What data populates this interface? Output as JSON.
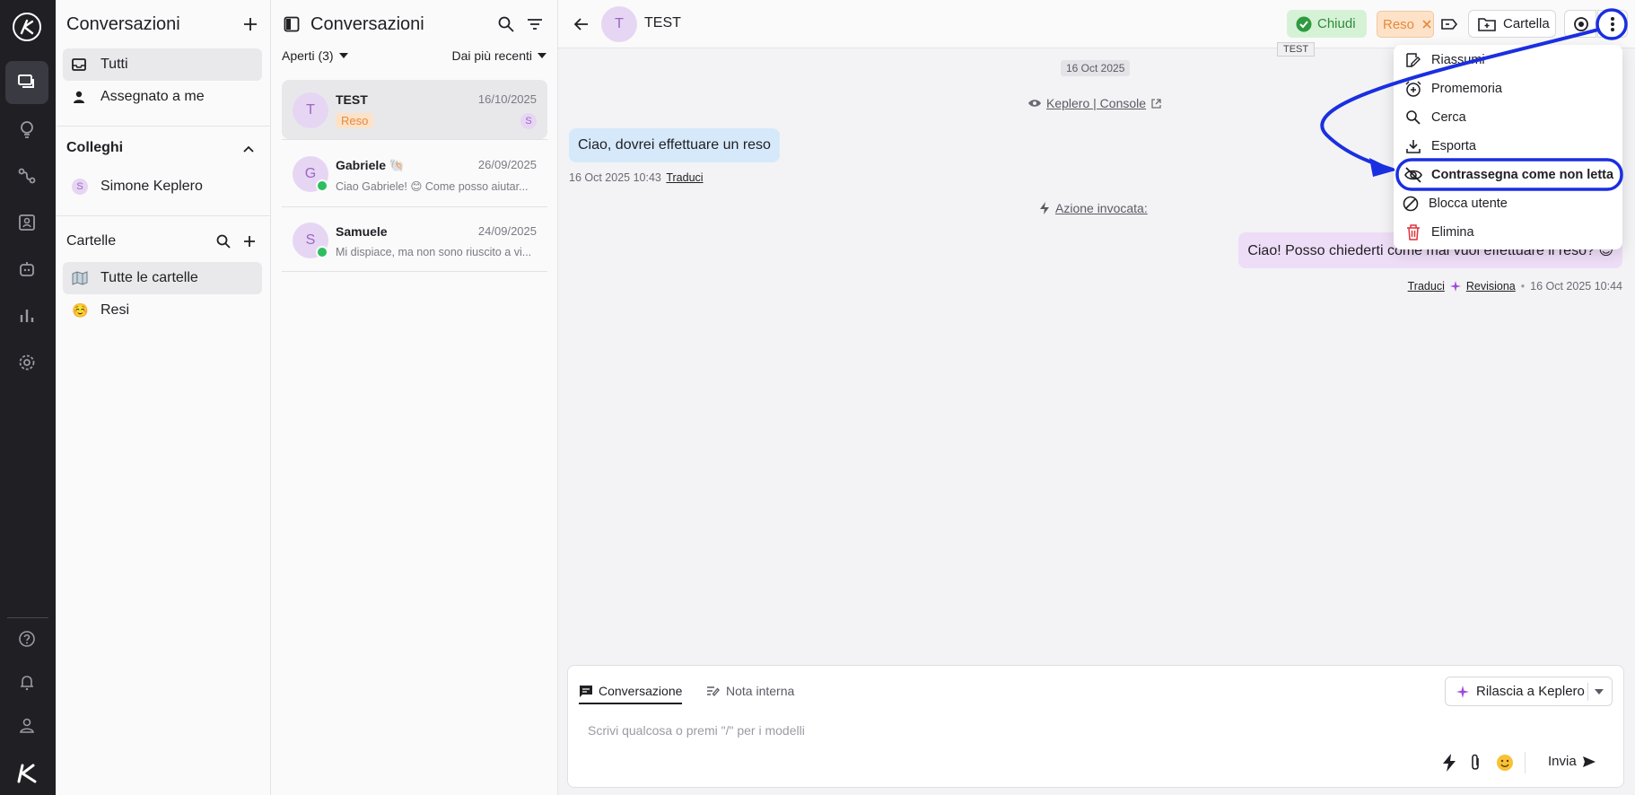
{
  "sidebar_panel": {
    "title": "Conversazioni",
    "nav": [
      {
        "label": "Tutti",
        "icon": "inbox-icon"
      },
      {
        "label": "Assegnato a me",
        "icon": "person-icon"
      }
    ],
    "colleagues_title": "Colleghi",
    "colleagues": [
      {
        "initial": "S",
        "name": "Simone Keplero"
      }
    ],
    "folders_title": "Cartelle",
    "folders": [
      {
        "label": "Tutte le cartelle",
        "icon": "folder-map-icon"
      },
      {
        "label": "Resi",
        "icon": "relieved-emoji-icon",
        "emoji": "☺️"
      }
    ]
  },
  "conv_list": {
    "title": "Conversazioni",
    "filter_label": "Aperti (3)",
    "sort_label": "Dai più recenti",
    "items": [
      {
        "initial": "T",
        "name": "TEST",
        "date": "16/10/2025",
        "tag": "Reso",
        "assignee": "S"
      },
      {
        "initial": "G",
        "name": "Gabriele 🐚",
        "date": "26/09/2025",
        "preview": "Ciao Gabriele! 😊 Come posso aiutar..."
      },
      {
        "initial": "S",
        "name": "Samuele",
        "date": "24/09/2025",
        "preview": "Mi dispiace, ma non sono riuscito a vi..."
      }
    ]
  },
  "chat": {
    "contact_initial": "T",
    "contact_name": "TEST",
    "tooltip": "TEST",
    "close_label": "Chiudi",
    "tag_label": "Reso",
    "folder_label": "Cartella",
    "date_pill": "16 Oct 2025",
    "source_link": "Keplero | Console",
    "incoming_text": "Ciao, dovrei effettuare un reso",
    "incoming_time": "16 Oct 2025 10:43",
    "translate_label": "Traduci",
    "action_label": "Azione invocata:",
    "outgoing_text": "Ciao! Posso chiederti come mai vuoi effettuare il reso? 😊",
    "outgoing_translate": "Traduci",
    "outgoing_review": "Revisiona",
    "outgoing_time": "16 Oct 2025 10:44"
  },
  "composer": {
    "tab_conversation": "Conversazione",
    "tab_note": "Nota interna",
    "release_label": "Rilascia a Keplero",
    "placeholder": "Scrivi qualcosa o premi \"/\" per i modelli",
    "send_label": "Invia"
  },
  "menu": {
    "items": [
      {
        "label": "Riassumi",
        "icon": "edit-note-icon"
      },
      {
        "label": "Promemoria",
        "icon": "alarm-add-icon"
      },
      {
        "label": "Cerca",
        "icon": "search-icon"
      },
      {
        "label": "Esporta",
        "icon": "download-icon"
      },
      {
        "label": "Contrassegna come non letta",
        "icon": "eye-off-icon"
      },
      {
        "label": "Blocca utente",
        "icon": "block-icon"
      },
      {
        "label": "Elimina",
        "icon": "trash-icon"
      }
    ]
  },
  "colors": {
    "annotation": "#1a2fe0",
    "danger": "#e0313c",
    "whatsapp": "#2dbe60"
  }
}
